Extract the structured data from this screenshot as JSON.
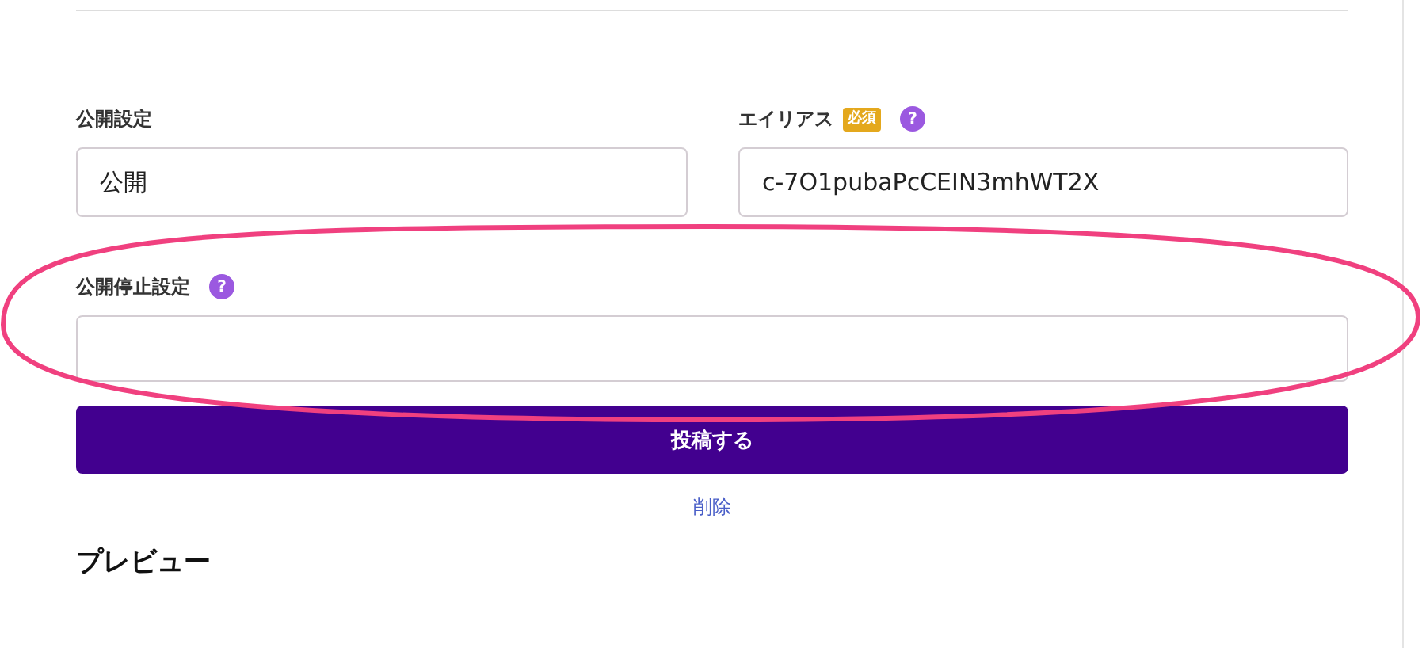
{
  "fields": [
    {
      "label": "公開設定",
      "value": "公開",
      "required": false,
      "help": false
    },
    {
      "label": "エイリアス",
      "value": "c-7O1pubaPcCEIN3mhWT2X",
      "required": true,
      "required_badge": "必須",
      "help": true,
      "help_icon": "?"
    },
    {
      "label": "公開停止設定",
      "required": false,
      "help": true,
      "help_icon": "?"
    }
  ],
  "submit_button": "投稿する",
  "delete_link": "削除",
  "preview_heading": "プレビュー",
  "annotation": {
    "kind": "ellipse",
    "color": "#f0407f"
  }
}
